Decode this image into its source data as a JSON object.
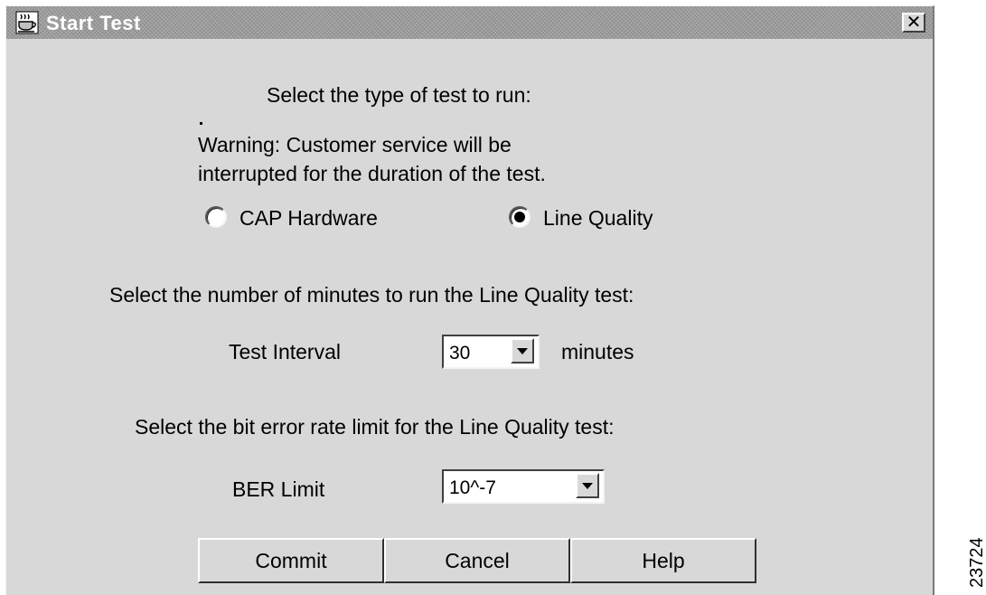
{
  "window": {
    "title": "Start Test",
    "close_label": "✕"
  },
  "prompt_test_type": "Select the type of test to run:",
  "warning_line1": "Warning: Customer service will be",
  "warning_line2": "interrupted for the duration of the test.",
  "test_types": [
    {
      "label": "CAP Hardware",
      "selected": false
    },
    {
      "label": "Line Quality",
      "selected": true
    }
  ],
  "prompt_minutes": "Select the number of minutes to run the Line Quality test:",
  "interval": {
    "label": "Test Interval",
    "value": "30",
    "unit": "minutes"
  },
  "prompt_ber": "Select the bit error rate limit for the Line Quality test:",
  "ber": {
    "label": "BER Limit",
    "value": "10^-7"
  },
  "buttons": {
    "commit": "Commit",
    "cancel": "Cancel",
    "help": "Help"
  },
  "figure_id": "23724"
}
